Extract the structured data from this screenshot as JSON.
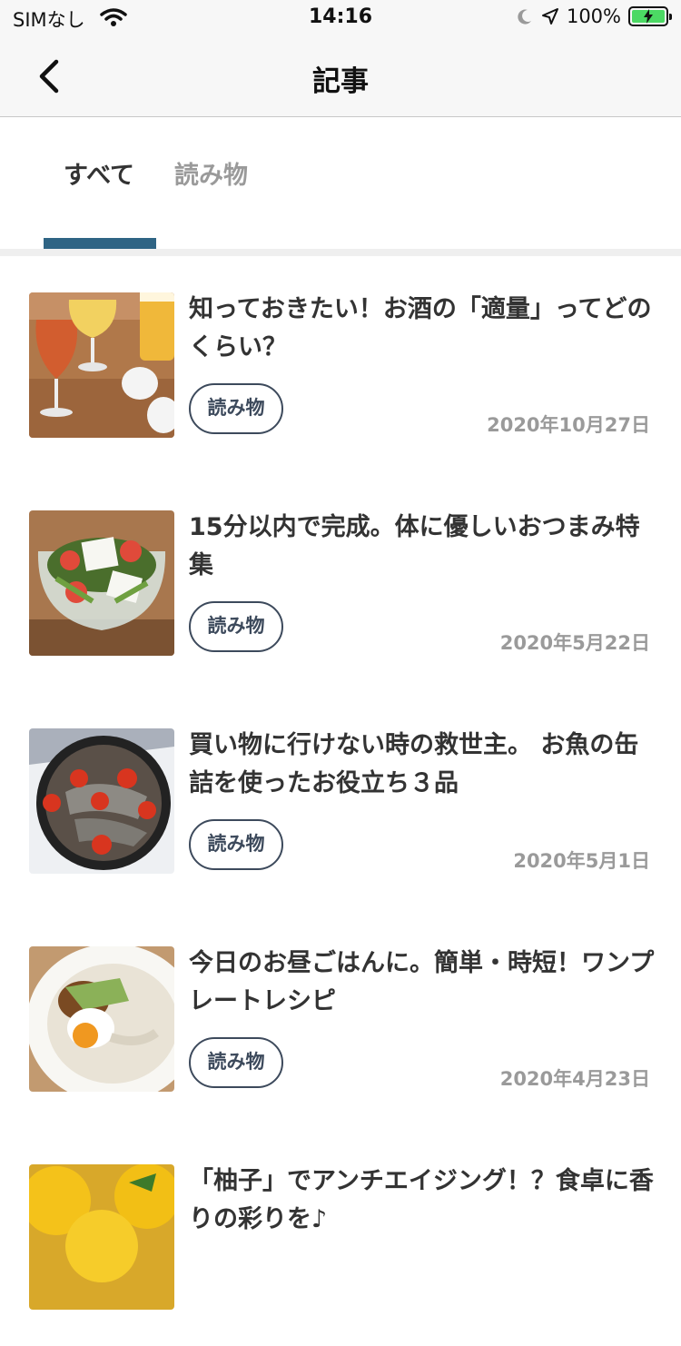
{
  "status_bar": {
    "carrier": "SIMなし",
    "time": "14:16",
    "battery": "100%"
  },
  "navbar": {
    "title": "記事"
  },
  "tabs": [
    {
      "label": "すべて",
      "active": true
    },
    {
      "label": "読み物",
      "active": false
    }
  ],
  "articles": [
    {
      "title": "知っておきたい！お酒の「適量」ってどのくらい？",
      "tag": "読み物",
      "date": "2020年10月27日",
      "image": "drinks"
    },
    {
      "title": "15分以内で完成。体に優しいおつまみ特集",
      "tag": "読み物",
      "date": "2020年5月22日",
      "image": "tofu-salad"
    },
    {
      "title": "買い物に行けない時の救世主。 お魚の缶詰を使ったお役立ち３品",
      "tag": "読み物",
      "date": "2020年5月1日",
      "image": "fish-skillet"
    },
    {
      "title": "今日のお昼ごはんに。簡単・時短！ワンプレートレシピ",
      "tag": "読み物",
      "date": "2020年4月23日",
      "image": "rice-bowl"
    },
    {
      "title": "「柚子」でアンチエイジング！？食卓に香りの彩りを♪",
      "tag": "読み物",
      "date": "",
      "image": "yuzu"
    }
  ],
  "colors": {
    "accent": "#2f6484",
    "tag_border": "#3d4a5c",
    "muted": "#9a9a9a"
  }
}
